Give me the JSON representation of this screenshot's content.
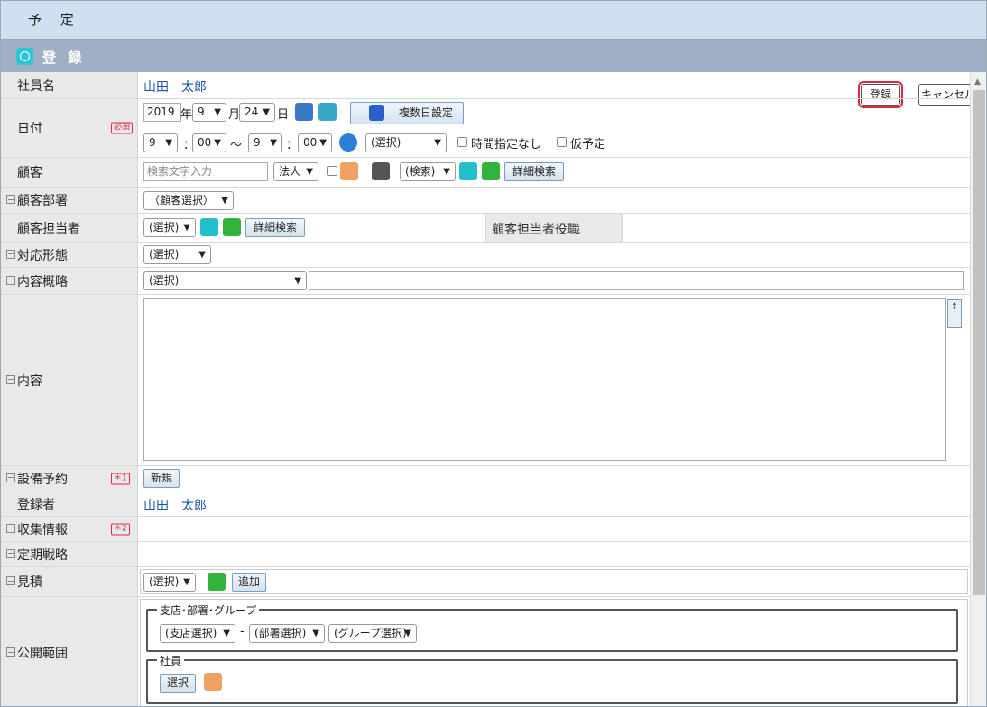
{
  "window_title": "予 定",
  "form_title": "登 録",
  "header_buttons": {
    "register": "登録",
    "cancel": "キャンセル"
  },
  "badges": {
    "required": "必須",
    "mark1": "＊1",
    "mark2": "＊2"
  },
  "labels": {
    "employee": "社員名",
    "date": "日付",
    "customer": "顧客",
    "customer_dept": "顧客部署",
    "customer_rep": "顧客担当者",
    "customer_rep_role": "顧客担当者役職",
    "response_type": "対応形態",
    "summary": "内容概略",
    "content": "内容",
    "equipment": "設備予約",
    "registrant": "登録者",
    "collect": "収集情報",
    "periodic": "定期戦略",
    "estimate": "見積",
    "scope": "公開範囲"
  },
  "employee_name": "山田　太郎",
  "registrant_name": "山田　太郎",
  "date": {
    "year": "2019",
    "year_unit": "年",
    "month": "9",
    "month_unit": "月",
    "day": "24",
    "day_unit": "日",
    "multi_day": "複数日設定",
    "start_hour": "9",
    "start_min": "00",
    "tilde": "〜",
    "end_hour": "9",
    "end_min": "00",
    "colon": "：",
    "time_select": "(選択)",
    "no_time": "時間指定なし",
    "tentative": "仮予定"
  },
  "customer": {
    "search_placeholder": "検索文字入力",
    "type": "法人",
    "search_select": "(検索)",
    "detail_search": "詳細検索"
  },
  "customer_dept_select": "（顧客選択）",
  "customer_rep_select": "(選択)",
  "customer_rep_detail": "詳細検索",
  "response_select": "(選択)",
  "summary_select": "(選択)",
  "equipment_new": "新規",
  "estimate": {
    "select": "(選択)",
    "add": "追加"
  },
  "scope": {
    "group_legend": "支店･部署･グループ",
    "branch": "(支店選択)",
    "dash": "-",
    "dept": "(部署選択)",
    "group": "(グループ選択)",
    "emp_legend": "社員",
    "emp_select": "選択"
  }
}
